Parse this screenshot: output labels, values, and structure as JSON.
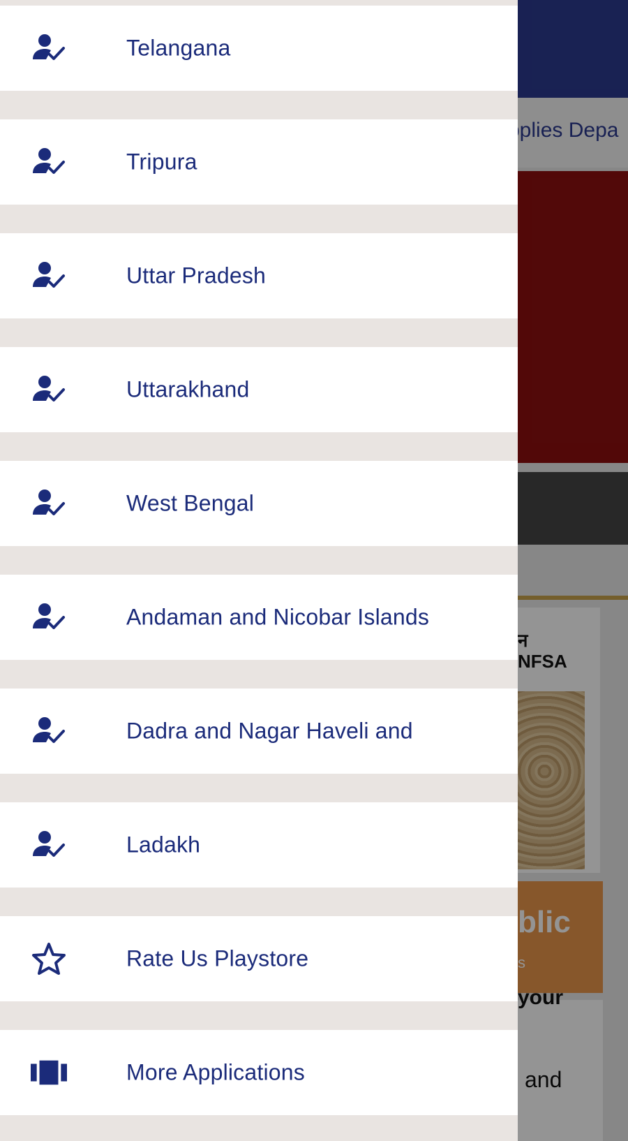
{
  "colors": {
    "drawer_text": "#1b2b7a",
    "drawer_icon": "#1b2b7a",
    "drawer_bg": "#ffffff",
    "drawer_divider": "#e9e4e1",
    "background_appbar": "#2b3a8f",
    "background_banner": "#8e0f0f"
  },
  "background": {
    "subtitle_fragment": "pplies Depa",
    "card_logo_hindi": "न",
    "card_logo": "NFSA",
    "orange_heading_fragment": "blic",
    "orange_subtext_fragment": "s",
    "text_fragment_1": "your",
    "text_fragment_2": "and"
  },
  "drawer": {
    "items": [
      {
        "label": "Telangana",
        "icon": "person-check-icon"
      },
      {
        "label": "Tripura",
        "icon": "person-check-icon"
      },
      {
        "label": "Uttar Pradesh",
        "icon": "person-check-icon"
      },
      {
        "label": "Uttarakhand",
        "icon": "person-check-icon"
      },
      {
        "label": "West Bengal",
        "icon": "person-check-icon"
      },
      {
        "label": "Andaman and Nicobar Islands",
        "icon": "person-check-icon"
      },
      {
        "label": "Dadra and Nagar Haveli and",
        "icon": "person-check-icon"
      },
      {
        "label": "Ladakh",
        "icon": "person-check-icon"
      },
      {
        "label": "Rate Us Playstore",
        "icon": "star-outline-icon"
      },
      {
        "label": "More Applications",
        "icon": "apps-carousel-icon"
      }
    ]
  }
}
